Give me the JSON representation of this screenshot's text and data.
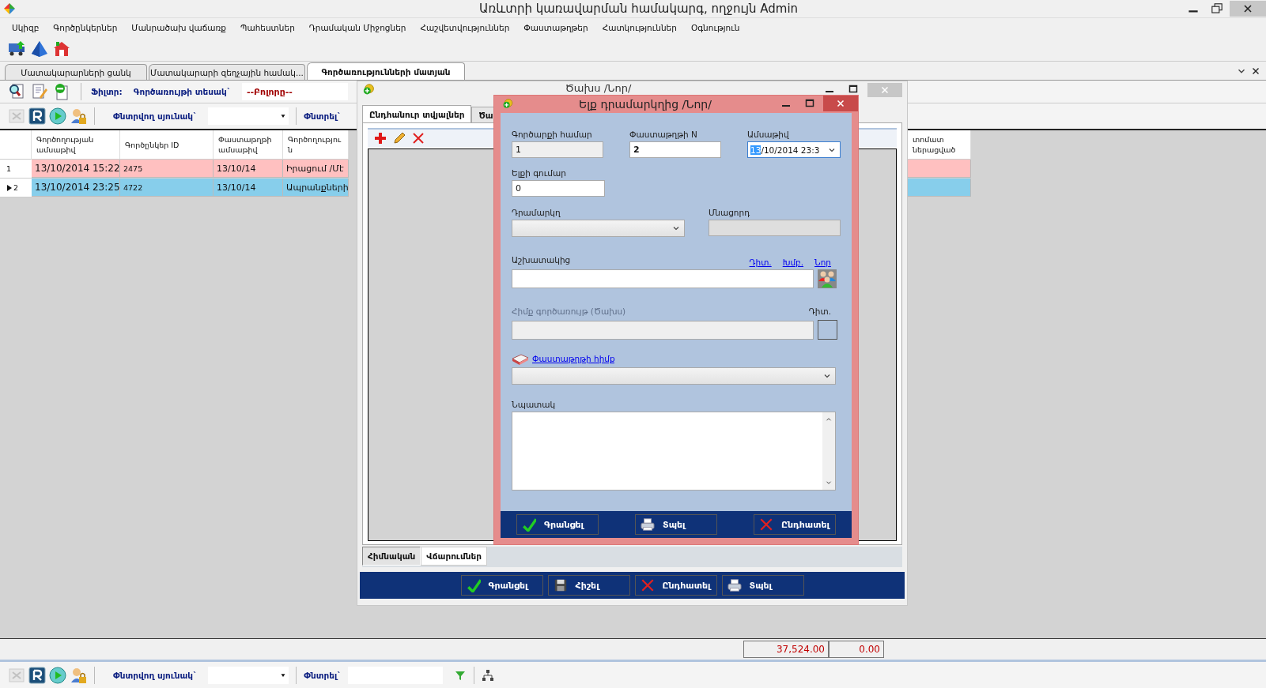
{
  "window": {
    "title": "Առևտրի կառավարման համակարգ, ողջույն Admin"
  },
  "menu": [
    "Սկիզբ",
    "Գործընկերներ",
    "Մանրածախ վաճառք",
    "Պահեստներ",
    "Դրամական Միջոցներ",
    "Հաշվետվություններ",
    "Փաստաթղթեր",
    "Հատկություններ",
    "Օգնություն"
  ],
  "tabs": [
    {
      "label": "Մատակարարների ցանկ",
      "selected": false
    },
    {
      "label": "Մատակարարի զեղչային համակ...",
      "selected": false
    },
    {
      "label": "Գործառությունների մատյան",
      "selected": true
    }
  ],
  "filter_bar": {
    "label": "Ֆիլտր:",
    "type_label": "Գործառույթի տեսակ`",
    "type_value": "--Բոլորը--"
  },
  "search_bar": {
    "column_label": "Փնտրվող սյունակ`",
    "search_label": "Փնտրել`",
    "export_disabled": true
  },
  "table": {
    "columns": [
      "Գործողության ամսաթիվ",
      "Գործընկեր ID",
      "Փաստաթղթի ամսաթիվ",
      "Գործողություն",
      "տոմատ ներացված"
    ],
    "rows": [
      {
        "marker": "1",
        "selected": false,
        "color": "#ffc0c0",
        "cells": [
          "13/10/2014 15:22",
          "2475",
          "13/10/14",
          "Իրացում /Մէ",
          ""
        ]
      },
      {
        "marker": "2",
        "selected": true,
        "color": "#87ceeb",
        "cells": [
          "13/10/2014 23:25",
          "4722",
          "13/10/14",
          "Ապրանքների",
          ""
        ]
      }
    ]
  },
  "status_bar": {
    "totals": [
      "37,524.00",
      "0.00"
    ]
  },
  "bottom_bar": {
    "column_label": "Փնտրվող սյունակ`",
    "search_label": "Փնտրել`",
    "export_disabled": true
  },
  "expense_window": {
    "title": "Ծախս /Նոր/",
    "tabs": [
      {
        "label": "Ընդհանուր տվյալներ",
        "selected": true
      },
      {
        "label": "Ծա",
        "selected": false
      }
    ],
    "bottom_tabs": [
      {
        "label": "Հիմնական",
        "selected": true
      },
      {
        "label": "Վճարումներ",
        "selected": false
      }
    ],
    "buttons": [
      {
        "kind": "save",
        "label": "Գրանցել"
      },
      {
        "kind": "remember",
        "label": "Հիշել"
      },
      {
        "kind": "cancel",
        "label": "Ընդհատել"
      },
      {
        "kind": "print",
        "label": "Տպել"
      }
    ]
  },
  "dialog": {
    "title": "Ելք դրամարկղից /Նոր/",
    "deal_number": {
      "label": "Գործարքի համար",
      "value": "1",
      "disabled": true
    },
    "doc_number": {
      "label": "Փաստաթղթի N",
      "value": "2"
    },
    "date": {
      "label": "Ամսաթիվ",
      "value_selected": "13",
      "value_rest": "/10/2014 23:3"
    },
    "amount": {
      "label": "Ելքի գումար",
      "value": "0"
    },
    "cashbox": {
      "label": "Դրամարկղ"
    },
    "balance": {
      "label": "Մնացորդ",
      "disabled": true
    },
    "employee": {
      "label": "Աշխատակից",
      "links": [
        "Դիտ.",
        "Խմբ.",
        "Նոր"
      ]
    },
    "base_operation": {
      "label": "Հիմք գործառույթ (Ծախս)",
      "disabled": true,
      "view_label": "Դիտ."
    },
    "doc_base": {
      "link": "Փաստաթղթի հիմք"
    },
    "purpose": {
      "label": "Նպատակ"
    },
    "buttons": [
      {
        "kind": "save",
        "label": "Գրանցել"
      },
      {
        "kind": "print",
        "label": "Տպել"
      },
      {
        "kind": "cancel",
        "label": "Ընդհատել"
      }
    ]
  }
}
